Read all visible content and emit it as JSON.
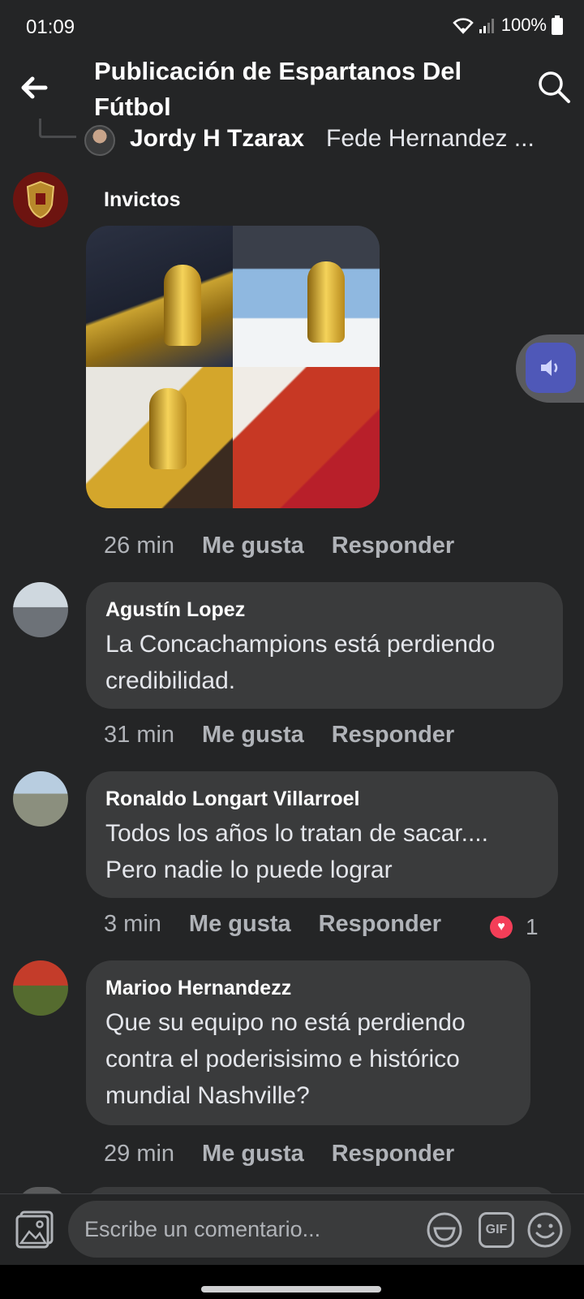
{
  "status": {
    "time": "01:09",
    "battery": "100%"
  },
  "header": {
    "title": "Publicación de Espartanos Del Fútbol"
  },
  "thread": {
    "name": "Jordy H Tzarax",
    "more": "Fede Hernandez ..."
  },
  "comments": [
    {
      "name": "Invictos",
      "time": "26 min",
      "like": "Me gusta",
      "reply": "Responder"
    },
    {
      "name": "Agustín Lopez",
      "text": "La Concachampions está perdiendo credibilidad.",
      "time": "31 min",
      "like": "Me gusta",
      "reply": "Responder"
    },
    {
      "name": "Ronaldo Longart Villarroel",
      "text": "Todos los años lo tratan de sacar.... Pero nadie lo puede lograr",
      "time": "3 min",
      "like": "Me gusta",
      "reply": "Responder",
      "reaction_count": "1"
    },
    {
      "name": "Marioo Hernandezz",
      "text": "Que su equipo no está perdiendo contra el poderisisimo e histórico mundial Nashville?",
      "time": "29 min",
      "like": "Me gusta",
      "reply": "Responder"
    }
  ],
  "composer": {
    "placeholder": "Escribe un comentario...",
    "gif_label": "GIF"
  },
  "icons": {
    "back": "arrow-left-icon",
    "search": "search-icon",
    "reaction": "heart-icon",
    "photo": "photo-icon",
    "sticker": "sticker-icon",
    "emoji": "emoji-icon",
    "speaker": "speaker-icon"
  },
  "colors": {
    "background": "#242526",
    "bubble": "#3a3b3c",
    "text_secondary": "#b0b3b8",
    "heart": "#f33e58",
    "float_button": "#4f58b8"
  }
}
